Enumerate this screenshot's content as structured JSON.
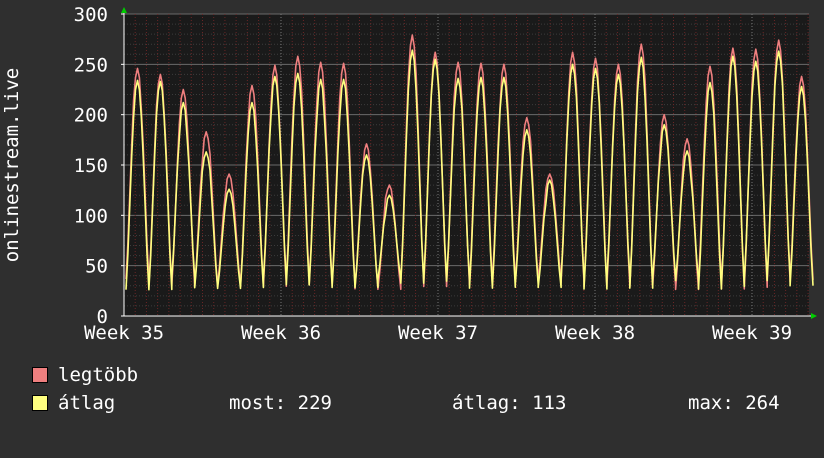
{
  "chart_data": {
    "type": "line",
    "ylabel": "onlinestream.live",
    "ylim": [
      0,
      300
    ],
    "yticks": [
      "0",
      "50",
      "100",
      "150",
      "200",
      "250",
      "300"
    ],
    "xtick_labels": [
      "Week 35",
      "Week 36",
      "Week 37",
      "Week 38",
      "Week 39"
    ],
    "grid": true,
    "colors": {
      "background": "#2f2f2f",
      "plot": "#1a1a1a",
      "grid": "#5a5a5a",
      "minor_grid": "#7a2a2a",
      "axis_arrow": "#00cc00"
    },
    "series": [
      {
        "name": "legtöbb",
        "color": "#ef7f7f",
        "peaks": [
          246,
          240,
          225,
          183,
          141,
          229,
          249,
          258,
          252,
          251,
          171,
          130,
          279,
          262,
          252,
          251,
          250,
          197,
          141,
          262,
          256,
          250,
          270,
          200,
          176,
          248,
          266,
          265,
          274,
          238
        ]
      },
      {
        "name": "átlag",
        "color": "#ffff7f",
        "peaks": [
          234,
          233,
          212,
          163,
          126,
          212,
          238,
          241,
          235,
          235,
          160,
          120,
          264,
          255,
          236,
          237,
          237,
          185,
          135,
          250,
          246,
          240,
          257,
          190,
          164,
          232,
          258,
          253,
          263,
          228
        ]
      }
    ]
  },
  "legend": {
    "items": [
      {
        "label": "legtöbb",
        "color": "#ef7f7f"
      },
      {
        "label": "átlag",
        "color": "#ffff7f"
      }
    ],
    "stats": {
      "most": "most: 229",
      "atlag": "átlag: 113",
      "max": "max: 264"
    }
  }
}
